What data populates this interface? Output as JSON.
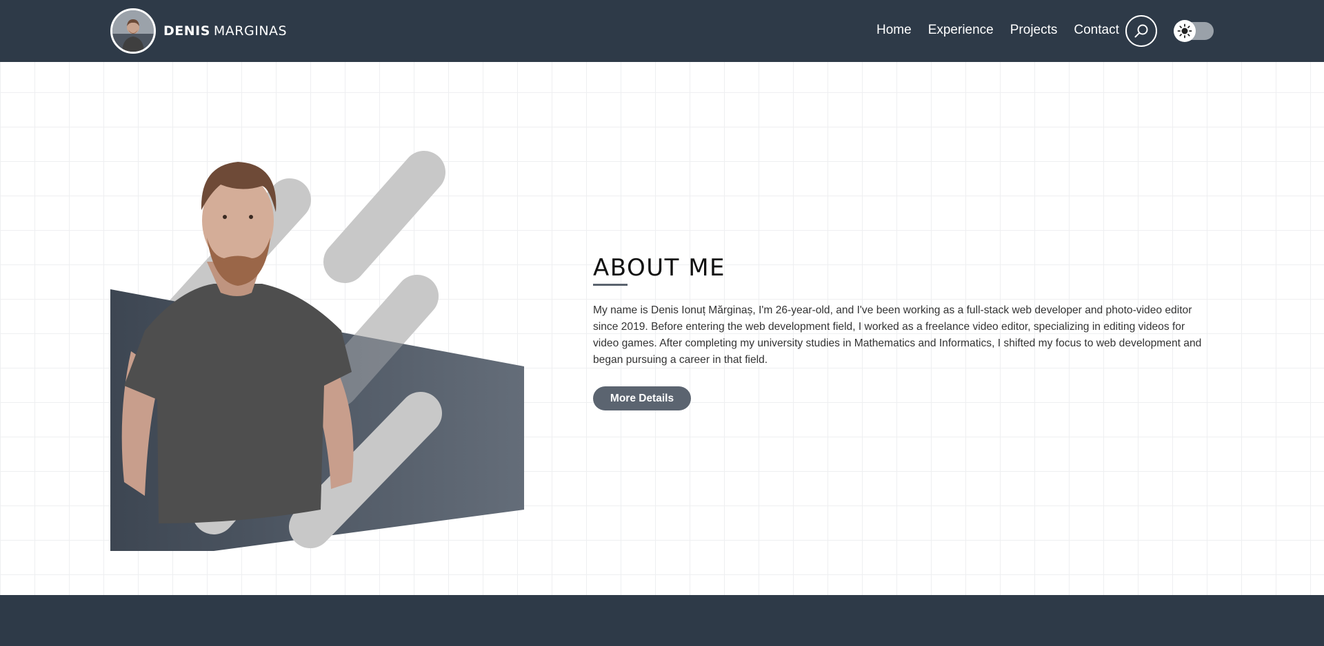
{
  "brand": {
    "first_name": "Denis",
    "last_name": "Marginas"
  },
  "nav": {
    "links": [
      {
        "label": "Home"
      },
      {
        "label": "Experience"
      },
      {
        "label": "Projects"
      },
      {
        "label": "Contact"
      }
    ]
  },
  "icons": {
    "search": "search-icon",
    "theme": "sun-icon",
    "avatar": "avatar-photo"
  },
  "about": {
    "title": "About Me",
    "paragraph": "My name is Denis Ionuț Mărginaș, I'm 26-year-old, and I've been working as a full-stack web developer and photo-video editor since 2019. Before entering the web development field, I worked as a freelance video editor, specializing in editing videos for video games. After completing my university studies in Mathematics and Informatics, I shifted my focus to web development and began pursuing a career in that field.",
    "button_label": "More Details"
  },
  "colors": {
    "nav_background": "#2e3a48",
    "button_background": "#5b6470",
    "accent_shapes": "#c8c8c8"
  }
}
